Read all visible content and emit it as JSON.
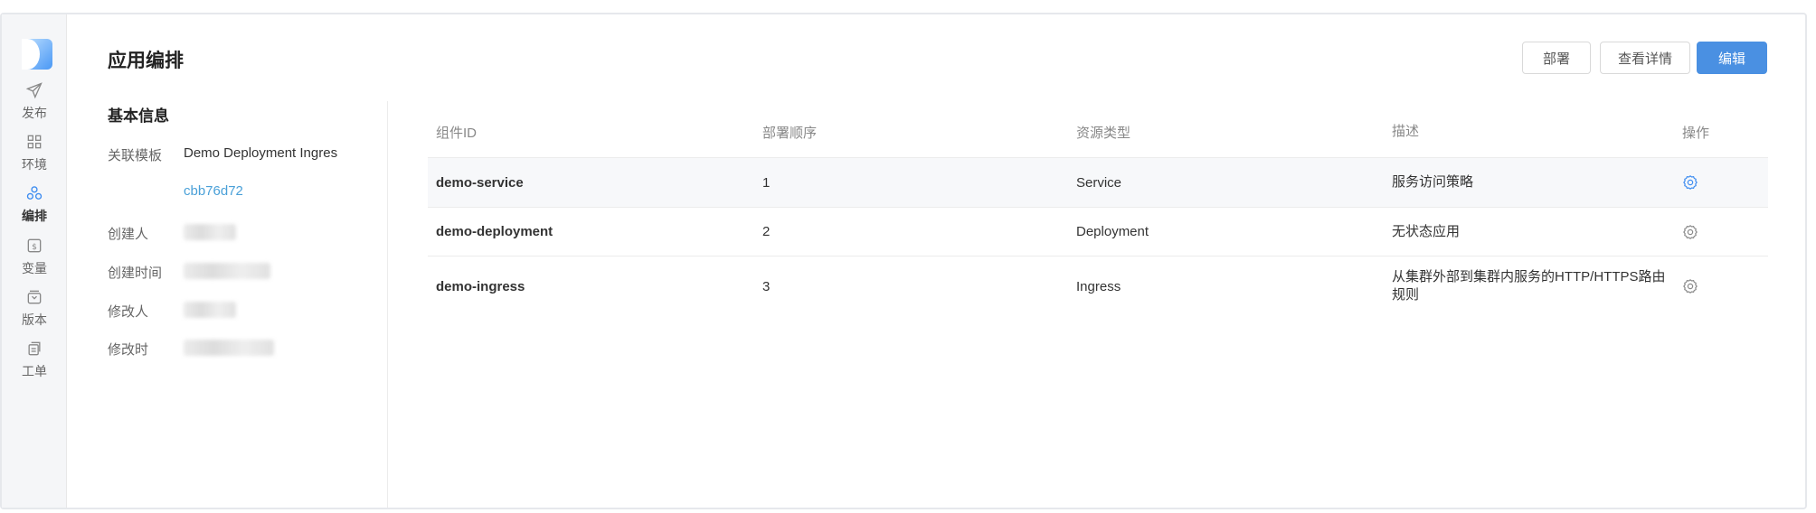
{
  "sidebar": {
    "items": [
      {
        "label": "发布",
        "icon": "send-icon"
      },
      {
        "label": "环境",
        "icon": "grid-icon"
      },
      {
        "label": "编排",
        "icon": "orchestration-icon",
        "active": true
      },
      {
        "label": "变量",
        "icon": "dollar-icon"
      },
      {
        "label": "版本",
        "icon": "archive-icon"
      },
      {
        "label": "工单",
        "icon": "ticket-icon"
      }
    ]
  },
  "header": {
    "title": "应用编排",
    "deploy_label": "部署",
    "details_label": "查看详情",
    "edit_label": "编辑"
  },
  "basic_info": {
    "title": "基本信息",
    "template_label": "关联模板",
    "template_value": "Demo Deployment Ingres",
    "template_hash": "cbb76d72",
    "creator_label": "创建人",
    "created_time_label": "创建时间",
    "modifier_label": "修改人",
    "modified_time_label": "修改时"
  },
  "table": {
    "columns": [
      "组件ID",
      "部署顺序",
      "资源类型",
      "描述",
      "操作"
    ],
    "rows": [
      {
        "id": "demo-service",
        "order": "1",
        "type": "Service",
        "desc": "服务访问策略"
      },
      {
        "id": "demo-deployment",
        "order": "2",
        "type": "Deployment",
        "desc": "无状态应用"
      },
      {
        "id": "demo-ingress",
        "order": "3",
        "type": "Ingress",
        "desc": "从集群外部到集群内服务的HTTP/HTTPS路由规则"
      }
    ]
  },
  "colors": {
    "accent": "#4a90e2",
    "link": "#4aa0d8",
    "sidebar_bg": "#f5f6f8"
  }
}
